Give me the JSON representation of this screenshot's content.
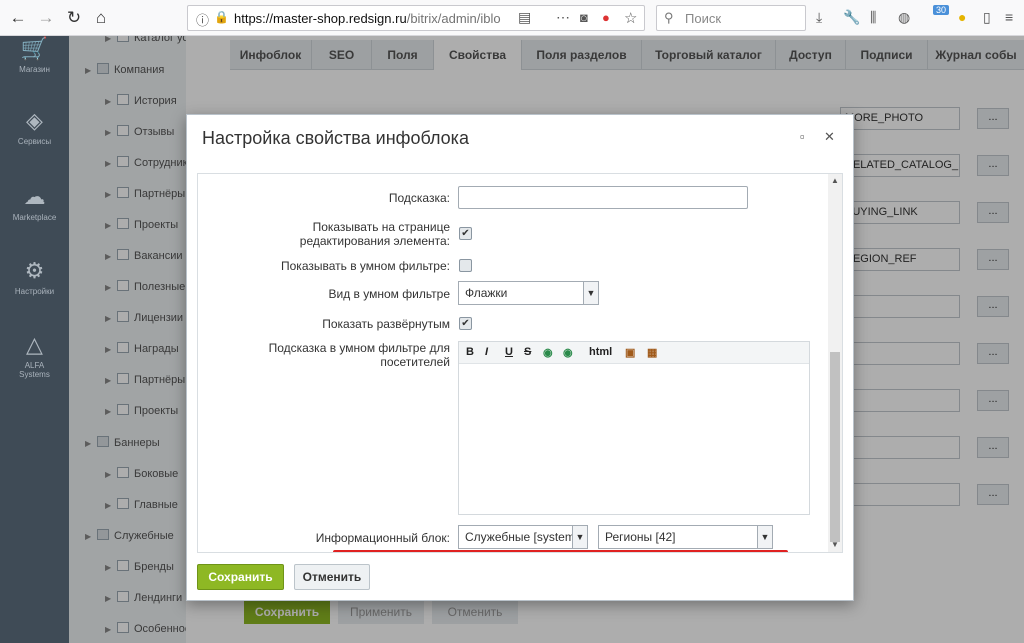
{
  "browser": {
    "url_domain": "https://master-shop.redsign.ru",
    "url_path": "/bitrix/admin/iblo",
    "search_placeholder": "Поиск",
    "badge": "30"
  },
  "sidebar": {
    "items": [
      {
        "label": "Магазин",
        "icon": "cart-icon"
      },
      {
        "label": "Сервисы",
        "icon": "layers-icon"
      },
      {
        "label": "Marketplace",
        "icon": "cloud-download-icon"
      },
      {
        "label": "Настройки",
        "icon": "gear-icon"
      },
      {
        "label": "ALFA Systems",
        "icon": "alfa-logo-icon"
      }
    ]
  },
  "tree": {
    "items": [
      {
        "label": "Каталог услуг",
        "level": 2
      },
      {
        "label": "Компания",
        "level": 1
      },
      {
        "label": "История",
        "level": 2
      },
      {
        "label": "Отзывы",
        "level": 2
      },
      {
        "label": "Сотрудники",
        "level": 2
      },
      {
        "label": "Партнёры",
        "level": 2
      },
      {
        "label": "Проекты",
        "level": 2
      },
      {
        "label": "Вакансии",
        "level": 2
      },
      {
        "label": "Полезные",
        "level": 2
      },
      {
        "label": "Лицензии",
        "level": 2
      },
      {
        "label": "Награды",
        "level": 2
      },
      {
        "label": "Партнёры",
        "level": 2
      },
      {
        "label": "Проекты",
        "level": 2
      },
      {
        "label": "Баннеры",
        "level": 1
      },
      {
        "label": "Боковые",
        "level": 2
      },
      {
        "label": "Главные",
        "level": 2
      },
      {
        "label": "Служебные",
        "level": 1
      },
      {
        "label": "Бренды",
        "level": 2
      },
      {
        "label": "Лендинги",
        "level": 2
      },
      {
        "label": "Особенности",
        "level": 2
      }
    ]
  },
  "tabs": [
    "Инфоблок",
    "SEO",
    "Поля",
    "Свойства",
    "Поля разделов",
    "Торговый каталог",
    "Доступ",
    "Подписи",
    "Журнал собы"
  ],
  "bg_fields": [
    "MORE_PHOTO",
    "RELATED_CATALOG_ITE",
    "BUYING_LINK",
    "REGION_REF"
  ],
  "bg_buttons": {
    "save": "Сохранить",
    "apply": "Применить",
    "cancel": "Отменить"
  },
  "dialog": {
    "title": "Настройка свойства инфоблока",
    "fields": {
      "hint_label": "Подсказка:",
      "hint_value": "",
      "show_on_edit_label": "Показывать на странице редактирования элемента:",
      "show_on_edit_checked": true,
      "show_in_filter_label": "Показывать в умном фильтре:",
      "show_in_filter_checked": false,
      "filter_view_label": "Вид в умном фильтре",
      "filter_view_value": "Флажки",
      "show_expanded_label": "Показать развёрнутым",
      "show_expanded_checked": true,
      "filter_hint_label": "Подсказка в умном фильтре для посетителей",
      "iblock_label": "Информационный блок:",
      "iblock_type_value": "Служебные [system",
      "iblock_value": "Регионы [42]"
    },
    "editor_toolbar": [
      "B",
      "I",
      "U",
      "S",
      "html"
    ],
    "buttons": {
      "save": "Сохранить",
      "cancel": "Отменить"
    }
  }
}
